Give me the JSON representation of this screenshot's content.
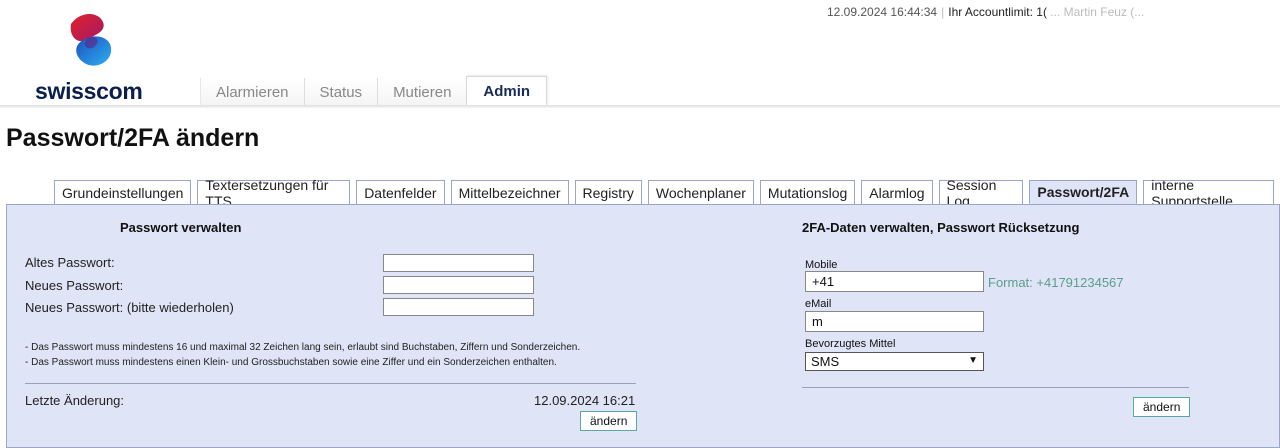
{
  "header": {
    "datetime": "12.09.2024 16:44:34",
    "separator": "|",
    "account_limit_label": "Ihr Accountlimit: 1(",
    "account_limit_rest": "... Martin Feuz (...",
    "logo_text": "swisscom"
  },
  "main_tabs": [
    {
      "label": "Alarmieren"
    },
    {
      "label": "Status"
    },
    {
      "label": "Mutieren"
    },
    {
      "label": "Admin"
    }
  ],
  "page_title": "Passwort/2FA ändern",
  "sub_tabs": [
    {
      "label": "Grundeinstellungen"
    },
    {
      "label": "Textersetzungen für TTS"
    },
    {
      "label": "Datenfelder"
    },
    {
      "label": "Mittelbezeichner"
    },
    {
      "label": "Registry"
    },
    {
      "label": "Wochenplaner"
    },
    {
      "label": "Mutationslog"
    },
    {
      "label": "Alarmlog"
    },
    {
      "label": "Session Log"
    },
    {
      "label": "Passwort/2FA"
    },
    {
      "label": "interne Supportstelle"
    }
  ],
  "password": {
    "title": "Passwort verwalten",
    "old_label": "Altes Passwort:",
    "new_label": "Neues Passwort:",
    "repeat_label": "Neues Passwort: (bitte wiederholen)",
    "note1": "- Das Passwort muss mindestens 16 und maximal 32 Zeichen lang sein, erlaubt sind Buchstaben, Ziffern und Sonderzeichen.",
    "note2": "- Das Passwort muss mindestens einen Klein- und Grossbuchstaben sowie eine Ziffer und ein Sonderzeichen enthalten.",
    "last_change_label": "Letzte Änderung:",
    "last_change_value": "12.09.2024 16:21",
    "submit_label": "ändern"
  },
  "twofa": {
    "title": "2FA-Daten verwalten, Passwort Rücksetzung",
    "mobile_label": "Mobile",
    "mobile_value": "+41",
    "mobile_hint": "Format: +41791234567",
    "email_label": "eMail",
    "email_value": "m",
    "method_label": "Bevorzugtes Mittel",
    "method_value": "SMS",
    "submit_label": "ändern"
  },
  "colors": {
    "panel_bg": "#dfe4f7",
    "hint": "#5a9e8c",
    "logo_navy": "#0a1f4e",
    "logo_red": "#e4202a",
    "logo_blue": "#1f6fd0"
  }
}
